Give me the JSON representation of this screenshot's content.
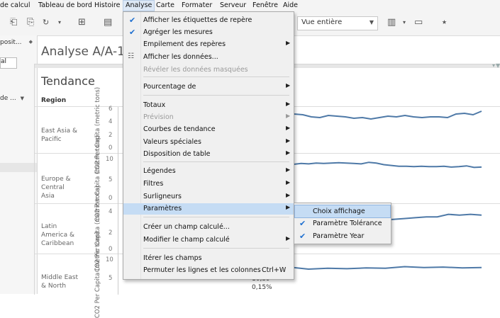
{
  "menubar": {
    "items": [
      "de calcul",
      "Tableau de bord",
      "Histoire",
      "Analyse",
      "Carte",
      "Formater",
      "Serveur",
      "Fenêtre",
      "Aide"
    ]
  },
  "toolbar": {
    "view_select": "Vue entière"
  },
  "left_pane": {
    "dropdown_1": "posit...",
    "box_1": "al",
    "dropdown_2": "de ..."
  },
  "sheet": {
    "title": "Analyse A/A-1"
  },
  "worksheet": {
    "title": "Tendance",
    "region_header": "Region",
    "axis_title": "CO2 Per Capita (metric tons)",
    "rows": [
      {
        "region": "East Asia & Pacific",
        "ticks": [
          "6",
          "4",
          "2",
          "0"
        ]
      },
      {
        "region": "Europe & Central Asia",
        "ticks": [
          "10",
          "5",
          "0"
        ]
      },
      {
        "region": "Latin America & Caribbean",
        "ticks": [
          "4",
          "2",
          "0"
        ]
      },
      {
        "region": "Middle East & North",
        "ticks": [
          "10",
          "5"
        ]
      }
    ],
    "tooltip_value": "10,39",
    "tooltip_pct": "0,15%"
  },
  "menu": {
    "items": [
      {
        "label": "Afficher les étiquettes de repère",
        "checked": true
      },
      {
        "label": "Agréger les mesures",
        "checked": true
      },
      {
        "label": "Empilement des repères",
        "submenu": true
      },
      {
        "label": "Afficher les données...",
        "icon": "table-icon"
      },
      {
        "label": "Révéler les données masquées",
        "disabled": true
      },
      {
        "label": "Pourcentage de",
        "submenu": true
      },
      {
        "label": "Totaux",
        "submenu": true
      },
      {
        "label": "Prévision",
        "submenu": true,
        "disabled": true
      },
      {
        "label": "Courbes de tendance",
        "submenu": true
      },
      {
        "label": "Valeurs spéciales",
        "submenu": true
      },
      {
        "label": "Disposition de table",
        "submenu": true
      },
      {
        "label": "Légendes",
        "submenu": true
      },
      {
        "label": "Filtres",
        "submenu": true
      },
      {
        "label": "Surligneurs",
        "submenu": true
      },
      {
        "label": "Paramètres",
        "submenu": true,
        "highlighted": true
      },
      {
        "label": "Créer un champ calculé..."
      },
      {
        "label": "Modifier le champ calculé",
        "submenu": true
      },
      {
        "label": "Itérer les champs"
      },
      {
        "label": "Permuter les lignes et les colonnes",
        "shortcut": "Ctrl+W"
      }
    ]
  },
  "submenu": {
    "items": [
      {
        "label": "Choix affichage",
        "highlighted": true
      },
      {
        "label": "Paramètre Tolérance",
        "checked": true
      },
      {
        "label": "Paramètre Year",
        "checked": true
      }
    ]
  },
  "chart_data": {
    "type": "line",
    "series_color": "#4e79a7",
    "series": [
      {
        "region": "East Asia & Pacific",
        "values": [
          4.0,
          3.8,
          4.1,
          4.8,
          4.7,
          4.4,
          4.3,
          4.6,
          4.5,
          4.4,
          4.2,
          4.3,
          4.1,
          4.3,
          4.5,
          4.4,
          4.6,
          4.4,
          4.3,
          4.4,
          4.4,
          4.3,
          4.8,
          4.9,
          4.7,
          5.2
        ]
      },
      {
        "region": "Europe & Central Asia",
        "values": [
          8.4,
          8.6,
          8.5,
          8.7,
          8.6,
          8.7,
          8.8,
          8.7,
          8.6,
          8.5,
          8.9,
          8.7,
          8.3,
          8.1,
          7.9,
          7.9,
          7.8,
          7.9,
          7.8,
          7.8,
          7.9,
          7.7,
          7.8,
          8.0,
          7.6,
          7.7
        ]
      },
      {
        "region": "Latin America & Caribbean",
        "values": [
          3.0,
          3.1,
          3.2,
          3.4,
          3.3,
          3.5,
          3.6,
          3.7,
          3.5,
          3.6,
          3.7,
          3.8,
          3.9,
          3.9,
          4.2,
          4.1,
          4.2,
          4.1
        ]
      },
      {
        "region": "Middle East & North",
        "values": [
          7.8,
          7.9,
          8.1,
          8.0,
          7.9,
          8.3,
          8.2,
          9.6,
          9.7,
          9.2,
          9.4,
          9.3,
          9.5,
          9.4,
          9.8,
          9.6,
          9.7,
          9.5,
          9.6
        ]
      }
    ]
  }
}
